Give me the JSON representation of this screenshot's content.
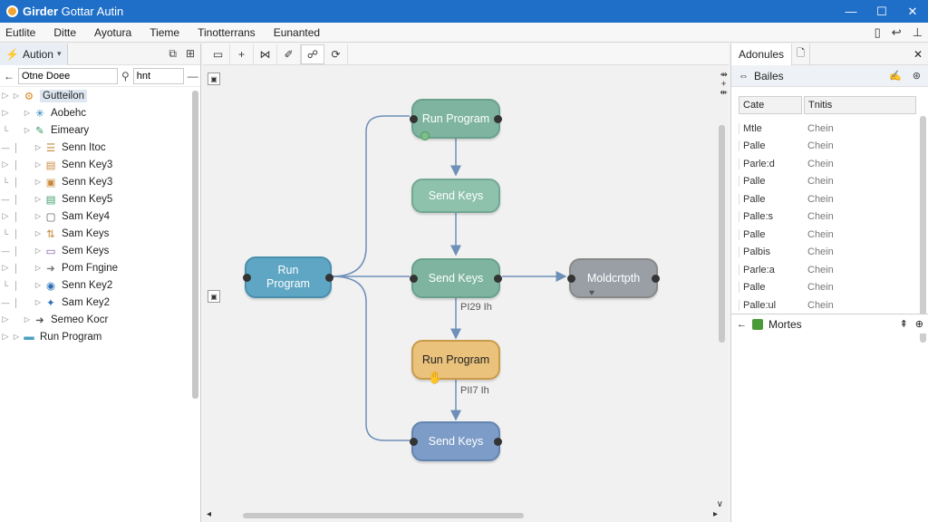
{
  "window": {
    "title_bold": "Girder",
    "title_rest": " Gottar Autin",
    "controls": [
      "—",
      "☐",
      "✕"
    ]
  },
  "menu": {
    "items": [
      "Eutlite",
      "Ditte",
      "Ayotura",
      "Tieme",
      "Tinotterrans",
      "Eunanted"
    ],
    "right_icons": [
      "▯",
      "↩",
      "⊥"
    ]
  },
  "left_panel": {
    "tab_label": "Aution",
    "tab_arrow": "▾",
    "header_icons": [
      "⧉",
      "⊞"
    ],
    "search_value": "Otne Doee",
    "filter_value": "hnt",
    "tree": [
      {
        "label": "Gutteilon",
        "icon": "folder-gear-icon",
        "glyph": "⚙",
        "color": "#d98a2b",
        "depth": 0,
        "selected": true
      },
      {
        "label": "Aobehc",
        "icon": "snowflake-icon",
        "glyph": "✳",
        "color": "#2a7fb8",
        "depth": 1
      },
      {
        "label": "Eimeary",
        "icon": "tool-icon",
        "glyph": "✎",
        "color": "#3a9a6a",
        "depth": 1
      },
      {
        "label": "Senn Itoc",
        "icon": "lines-icon",
        "glyph": "☰",
        "color": "#c98a3a",
        "depth": 2
      },
      {
        "label": "Senn Key3",
        "icon": "keyboard-icon",
        "glyph": "▤",
        "color": "#c98a3a",
        "depth": 2
      },
      {
        "label": "Senn Key3",
        "icon": "box-icon",
        "glyph": "▣",
        "color": "#c98a3a",
        "depth": 2
      },
      {
        "label": "Senn Key5",
        "icon": "list-icon",
        "glyph": "▤",
        "color": "#3a9a6a",
        "depth": 2
      },
      {
        "label": "Sam Key4",
        "icon": "square-icon",
        "glyph": "▢",
        "color": "#555",
        "depth": 2
      },
      {
        "label": "Sam Keys",
        "icon": "swap-icon",
        "glyph": "⇅",
        "color": "#c98a3a",
        "depth": 2
      },
      {
        "label": "Sem Keys",
        "icon": "window-icon",
        "glyph": "▭",
        "color": "#7a4fa0",
        "depth": 2
      },
      {
        "label": "Pom Fngine",
        "icon": "arrow-right-icon",
        "glyph": "➜",
        "color": "#777",
        "depth": 2
      },
      {
        "label": "Senn Key2",
        "icon": "globe-icon",
        "glyph": "◉",
        "color": "#2a6fb8",
        "depth": 2
      },
      {
        "label": "Sam Key2",
        "icon": "compass-icon",
        "glyph": "✦",
        "color": "#2a6fb8",
        "depth": 2
      },
      {
        "label": "Semeo Kocr",
        "icon": "arrow-icon",
        "glyph": "➜",
        "color": "#555",
        "depth": 1
      },
      {
        "label": "Run Program",
        "icon": "folder-icon",
        "glyph": "▬",
        "color": "#4aa0c0",
        "depth": 0
      }
    ]
  },
  "canvas": {
    "toolbar": [
      "▭",
      "+",
      "⋈",
      "✐",
      "☍",
      "⟳"
    ],
    "nodes": [
      {
        "id": "n1",
        "label": "Run Program",
        "style": "green"
      },
      {
        "id": "n2",
        "label": "Send Keys",
        "style": "green-light"
      },
      {
        "id": "n3",
        "label": "Run\nProgram",
        "style": "blue"
      },
      {
        "id": "n4",
        "label": "Send Keys",
        "style": "green"
      },
      {
        "id": "n5",
        "label": "Moldcrtpth",
        "style": "gray"
      },
      {
        "id": "n6",
        "label": "Run Program",
        "style": "orange"
      },
      {
        "id": "n7",
        "label": "Send Keys",
        "style": "slate"
      }
    ],
    "edge_labels": [
      "PI29 Ih",
      "PII7 Ih"
    ],
    "side_buttons": [
      "▣",
      "▣"
    ]
  },
  "right_panel": {
    "tab_label": "Adonules",
    "tab2_icon": "🗋",
    "close": "✕",
    "sub_label": "Bailes",
    "sub_icons": [
      "✍",
      "⊛"
    ],
    "table_headers": [
      "Cate",
      "Tnitis"
    ],
    "rows": [
      {
        "name": "Mtle",
        "value": "Chein"
      },
      {
        "name": "Palle",
        "value": "Chein"
      },
      {
        "name": "Parle:d",
        "value": "Chein"
      },
      {
        "name": "Palle",
        "value": "Chein"
      },
      {
        "name": "Palle",
        "value": "Chein"
      },
      {
        "name": "Palle:s",
        "value": "Chein"
      },
      {
        "name": "Palle",
        "value": "Chein"
      },
      {
        "name": "Palbis",
        "value": "Chein"
      },
      {
        "name": "Parle:a",
        "value": "Chein"
      },
      {
        "name": "Palle",
        "value": "Chein"
      },
      {
        "name": "Palle:ul",
        "value": "Chein"
      }
    ],
    "bottom_label": "Mortes",
    "bottom_icons": [
      "⇞",
      "⊕"
    ]
  },
  "colors": {
    "titlebar": "#1f6fc9",
    "edge": "#6e8fb8"
  }
}
